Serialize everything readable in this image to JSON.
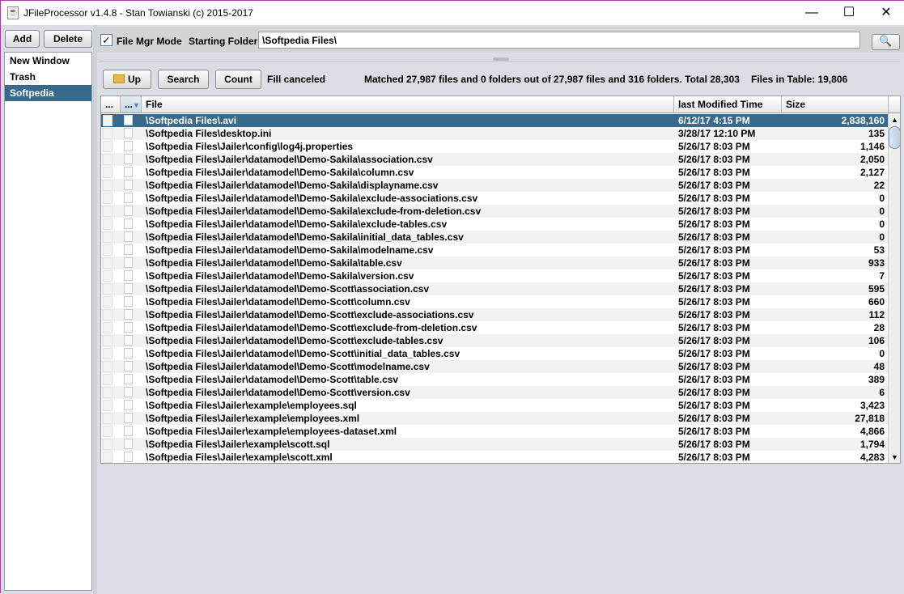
{
  "window": {
    "title": "JFileProcessor v1.4.8 - Stan Towianski  (c) 2015-2017",
    "minimize": "—",
    "maximize": "☐",
    "close": "✕"
  },
  "left": {
    "add_label": "Add",
    "delete_label": "Delete",
    "items": [
      {
        "label": "New Window"
      },
      {
        "label": "Trash"
      },
      {
        "label": "Softpedia",
        "selected": true
      }
    ]
  },
  "top": {
    "file_mgr_mode_label": "File Mgr Mode",
    "file_mgr_mode_checked": true,
    "starting_folder_label": "Starting Folder:",
    "starting_folder_value": "\\Softpedia Files\\"
  },
  "toolbar": {
    "up_label": "Up",
    "search_label": "Search",
    "count_label": "Count",
    "status": "Fill canceled",
    "matched": "Matched 27,987 files and 0 folders out of 27,987 files and 316 folders.  Total 28,303",
    "files_in_table": "Files in Table: 19,806"
  },
  "table": {
    "columns": [
      "...",
      "...",
      "File",
      "last Modified Time",
      "Size"
    ],
    "rows": [
      [
        "\\Softpedia Files\\.avi",
        "6/12/17 4:15 PM",
        "2,838,160"
      ],
      [
        "\\Softpedia Files\\desktop.ini",
        "3/28/17 12:10 PM",
        "135"
      ],
      [
        "\\Softpedia Files\\Jailer\\config\\log4j.properties",
        "5/26/17 8:03 PM",
        "1,146"
      ],
      [
        "\\Softpedia Files\\Jailer\\datamodel\\Demo-Sakila\\association.csv",
        "5/26/17 8:03 PM",
        "2,050"
      ],
      [
        "\\Softpedia Files\\Jailer\\datamodel\\Demo-Sakila\\column.csv",
        "5/26/17 8:03 PM",
        "2,127"
      ],
      [
        "\\Softpedia Files\\Jailer\\datamodel\\Demo-Sakila\\displayname.csv",
        "5/26/17 8:03 PM",
        "22"
      ],
      [
        "\\Softpedia Files\\Jailer\\datamodel\\Demo-Sakila\\exclude-associations.csv",
        "5/26/17 8:03 PM",
        "0"
      ],
      [
        "\\Softpedia Files\\Jailer\\datamodel\\Demo-Sakila\\exclude-from-deletion.csv",
        "5/26/17 8:03 PM",
        "0"
      ],
      [
        "\\Softpedia Files\\Jailer\\datamodel\\Demo-Sakila\\exclude-tables.csv",
        "5/26/17 8:03 PM",
        "0"
      ],
      [
        "\\Softpedia Files\\Jailer\\datamodel\\Demo-Sakila\\initial_data_tables.csv",
        "5/26/17 8:03 PM",
        "0"
      ],
      [
        "\\Softpedia Files\\Jailer\\datamodel\\Demo-Sakila\\modelname.csv",
        "5/26/17 8:03 PM",
        "53"
      ],
      [
        "\\Softpedia Files\\Jailer\\datamodel\\Demo-Sakila\\table.csv",
        "5/26/17 8:03 PM",
        "933"
      ],
      [
        "\\Softpedia Files\\Jailer\\datamodel\\Demo-Sakila\\version.csv",
        "5/26/17 8:03 PM",
        "7"
      ],
      [
        "\\Softpedia Files\\Jailer\\datamodel\\Demo-Scott\\association.csv",
        "5/26/17 8:03 PM",
        "595"
      ],
      [
        "\\Softpedia Files\\Jailer\\datamodel\\Demo-Scott\\column.csv",
        "5/26/17 8:03 PM",
        "660"
      ],
      [
        "\\Softpedia Files\\Jailer\\datamodel\\Demo-Scott\\exclude-associations.csv",
        "5/26/17 8:03 PM",
        "112"
      ],
      [
        "\\Softpedia Files\\Jailer\\datamodel\\Demo-Scott\\exclude-from-deletion.csv",
        "5/26/17 8:03 PM",
        "28"
      ],
      [
        "\\Softpedia Files\\Jailer\\datamodel\\Demo-Scott\\exclude-tables.csv",
        "5/26/17 8:03 PM",
        "106"
      ],
      [
        "\\Softpedia Files\\Jailer\\datamodel\\Demo-Scott\\initial_data_tables.csv",
        "5/26/17 8:03 PM",
        "0"
      ],
      [
        "\\Softpedia Files\\Jailer\\datamodel\\Demo-Scott\\modelname.csv",
        "5/26/17 8:03 PM",
        "48"
      ],
      [
        "\\Softpedia Files\\Jailer\\datamodel\\Demo-Scott\\table.csv",
        "5/26/17 8:03 PM",
        "389"
      ],
      [
        "\\Softpedia Files\\Jailer\\datamodel\\Demo-Scott\\version.csv",
        "5/26/17 8:03 PM",
        "6"
      ],
      [
        "\\Softpedia Files\\Jailer\\example\\employees.sql",
        "5/26/17 8:03 PM",
        "3,423"
      ],
      [
        "\\Softpedia Files\\Jailer\\example\\employees.xml",
        "5/26/17 8:03 PM",
        "27,818"
      ],
      [
        "\\Softpedia Files\\Jailer\\example\\employees-dataset.xml",
        "5/26/17 8:03 PM",
        "4,866"
      ],
      [
        "\\Softpedia Files\\Jailer\\example\\scott.sql",
        "5/26/17 8:03 PM",
        "1,794"
      ],
      [
        "\\Softpedia Files\\Jailer\\example\\scott.xml",
        "5/26/17 8:03 PM",
        "4,283"
      ]
    ]
  },
  "colors": {
    "selection": "#386a8c",
    "panel": "#dadde3"
  }
}
